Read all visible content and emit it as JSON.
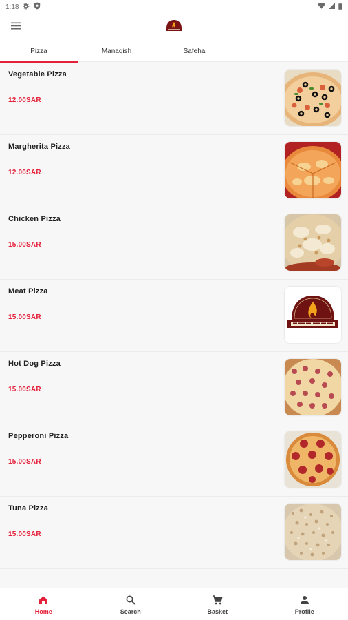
{
  "status": {
    "time": "1:18",
    "icons": [
      "gear-icon",
      "shield-icon",
      "wifi-icon",
      "signal-icon",
      "battery-icon"
    ]
  },
  "header": {
    "menu_icon": "hamburger-menu-icon",
    "logo": "restaurant-logo"
  },
  "tabs": [
    {
      "label": "Pizza",
      "active": true
    },
    {
      "label": "Manaqish",
      "active": false
    },
    {
      "label": "Safeha",
      "active": false
    }
  ],
  "colors": {
    "accent": "#e5203a",
    "background": "#f7f7f7"
  },
  "items": [
    {
      "name": "Vegetable Pizza",
      "price": "12.00SAR",
      "image": "vegetable-pizza"
    },
    {
      "name": "Margherita Pizza",
      "price": "12.00SAR",
      "image": "margherita-pizza"
    },
    {
      "name": "Chicken Pizza",
      "price": "15.00SAR",
      "image": "chicken-pizza"
    },
    {
      "name": "Meat Pizza",
      "price": "15.00SAR",
      "image": "restaurant-logo-placeholder"
    },
    {
      "name": "Hot Dog Pizza",
      "price": "15.00SAR",
      "image": "hot-dog-pizza"
    },
    {
      "name": "Pepperoni Pizza",
      "price": "15.00SAR",
      "image": "pepperoni-pizza"
    },
    {
      "name": "Tuna Pizza",
      "price": "15.00SAR",
      "image": "tuna-pizza"
    }
  ],
  "bottom_nav": [
    {
      "label": "Home",
      "icon": "home-icon",
      "active": true
    },
    {
      "label": "Search",
      "icon": "search-icon",
      "active": false
    },
    {
      "label": "Basket",
      "icon": "cart-icon",
      "active": false
    },
    {
      "label": "Profile",
      "icon": "person-icon",
      "active": false
    }
  ]
}
